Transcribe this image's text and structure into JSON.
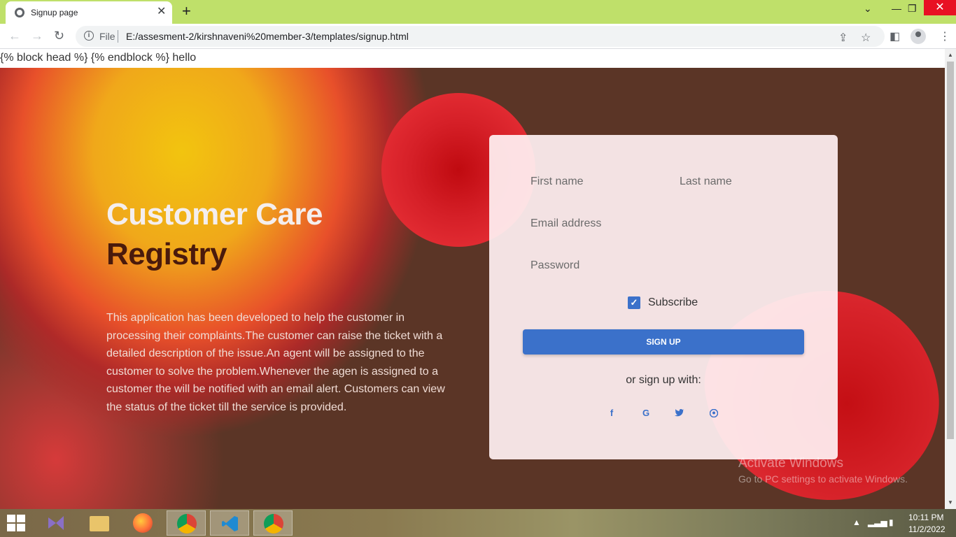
{
  "browser": {
    "tab_title": "Signup page",
    "tab_close": "✕",
    "new_tab": "+",
    "scheme_label": "File",
    "url": "E:/assesment-2/kirshnaveni%20member-3/templates/signup.html"
  },
  "page": {
    "template_text": "{% block head %} {% endblock %} hello",
    "headline_line1": "Customer Care",
    "headline_line2": "Registry",
    "description": "This application has been developed to help the customer in processing their complaints.The customer can raise the ticket with a detailed description of the issue.An agent will be assigned to the customer to solve the problem.Whenever the agen is assigned to a customer the will be notified with an email alert. Customers can view the status of the ticket till the service is provided."
  },
  "form": {
    "first_name_placeholder": "First name",
    "last_name_placeholder": "Last name",
    "email_placeholder": "Email address",
    "password_placeholder": "Password",
    "subscribe_label": "Subscribe",
    "subscribe_checked": true,
    "submit_label": "SIGN UP",
    "social_prompt": "or sign up with:",
    "social_icons": [
      "facebook-icon",
      "google-icon",
      "twitter-icon",
      "github-icon"
    ]
  },
  "watermark": {
    "line1": "Activate Windows",
    "line2": "Go to PC settings to activate Windows."
  },
  "taskbar": {
    "time": "10:11 PM",
    "date": "11/2/2022"
  },
  "colors": {
    "accent": "#3b71ca",
    "tab_strip": "#bfe06a",
    "close_button": "#e81123"
  }
}
